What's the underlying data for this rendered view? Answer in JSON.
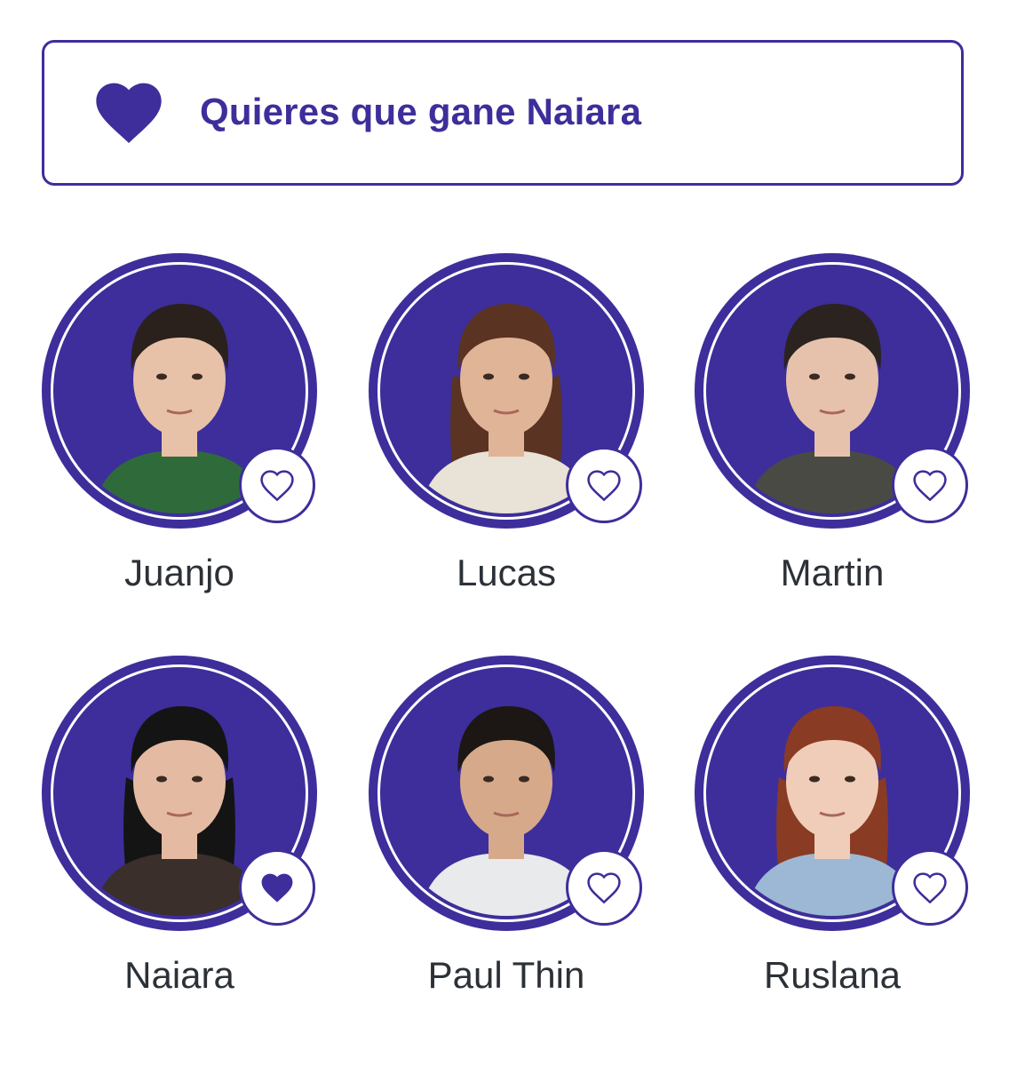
{
  "colors": {
    "accent": "#3d2e9b",
    "name_text": "#2c3138"
  },
  "banner": {
    "icon": "heart-filled-icon",
    "text": "Quieres que gane Naiara"
  },
  "contestants": [
    {
      "name": "Juanjo",
      "favorite": false,
      "icon": "heart-outline-icon"
    },
    {
      "name": "Lucas",
      "favorite": false,
      "icon": "heart-outline-icon"
    },
    {
      "name": "Martin",
      "favorite": false,
      "icon": "heart-outline-icon"
    },
    {
      "name": "Naiara",
      "favorite": true,
      "icon": "heart-filled-icon"
    },
    {
      "name": "Paul Thin",
      "favorite": false,
      "icon": "heart-outline-icon"
    },
    {
      "name": "Ruslana",
      "favorite": false,
      "icon": "heart-outline-icon"
    }
  ]
}
